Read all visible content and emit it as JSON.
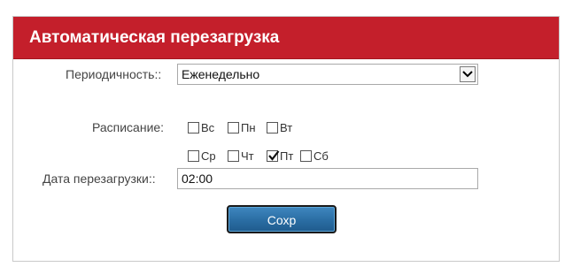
{
  "panel": {
    "title": "Автоматическая перезагрузка"
  },
  "frequency": {
    "label": "Периодичность::",
    "selected": "Еженедельно"
  },
  "schedule": {
    "label": "Расписание:",
    "days": [
      {
        "label": "Вс",
        "checked": false
      },
      {
        "label": "Пн",
        "checked": false
      },
      {
        "label": "Вт",
        "checked": false
      },
      {
        "label": "Ср",
        "checked": false
      },
      {
        "label": "Чт",
        "checked": false
      },
      {
        "label": "Пт",
        "checked": true
      },
      {
        "label": "Сб",
        "checked": false
      }
    ]
  },
  "reboot_time": {
    "label": "Дата перезагрузки::",
    "value": "02:00"
  },
  "save_button": {
    "label": "Сохр"
  },
  "colors": {
    "header": "#c41f2b",
    "button": "#2a6da3"
  }
}
